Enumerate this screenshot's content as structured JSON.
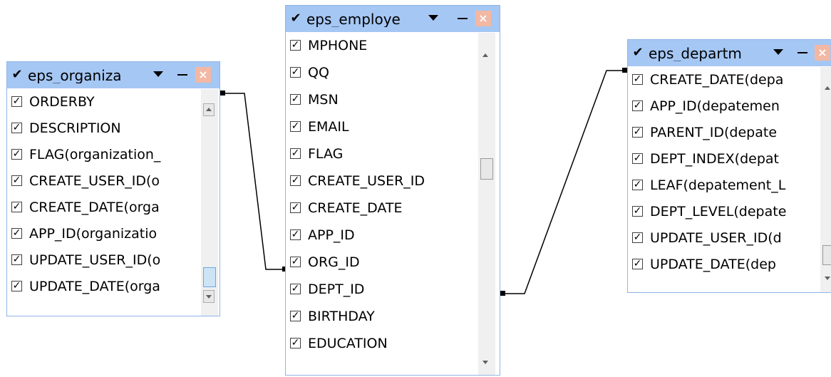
{
  "diagram": {
    "tables": [
      {
        "id": "org",
        "title": "eps_organiza",
        "columns": [
          "ORDERBY",
          "DESCRIPTION",
          "FLAG(organization_",
          "CREATE_USER_ID(o",
          "CREATE_DATE(orga",
          "APP_ID(organizatio",
          "UPDATE_USER_ID(o",
          "UPDATE_DATE(orga"
        ]
      },
      {
        "id": "emp",
        "title": "eps_employe",
        "columns": [
          "MPHONE",
          "QQ",
          "MSN",
          "EMAIL",
          "FLAG",
          "CREATE_USER_ID",
          "CREATE_DATE",
          "APP_ID",
          "ORG_ID",
          "DEPT_ID",
          "BIRTHDAY",
          "EDUCATION"
        ]
      },
      {
        "id": "dept",
        "title": "eps_departm",
        "columns": [
          "CREATE_DATE(depa",
          "APP_ID(depatemen",
          "PARENT_ID(depate",
          "DEPT_INDEX(depat",
          "LEAF(depatement_L",
          "DEPT_LEVEL(depate",
          "UPDATE_USER_ID(d",
          "UPDATE_DATE(dep"
        ]
      }
    ],
    "icons": {
      "checkbox": "check-icon",
      "menu": "dropdown-arrow-icon",
      "minimize": "minimize-icon",
      "close": "close-icon",
      "close_symbol": "×",
      "check_symbol": "✔",
      "checkbox_symbol": "✓"
    },
    "colors": {
      "header_bg": "#a5c7f4",
      "border": "#8fb4e6",
      "close_bg": "#f2b8a3",
      "connector": "#000000"
    }
  }
}
